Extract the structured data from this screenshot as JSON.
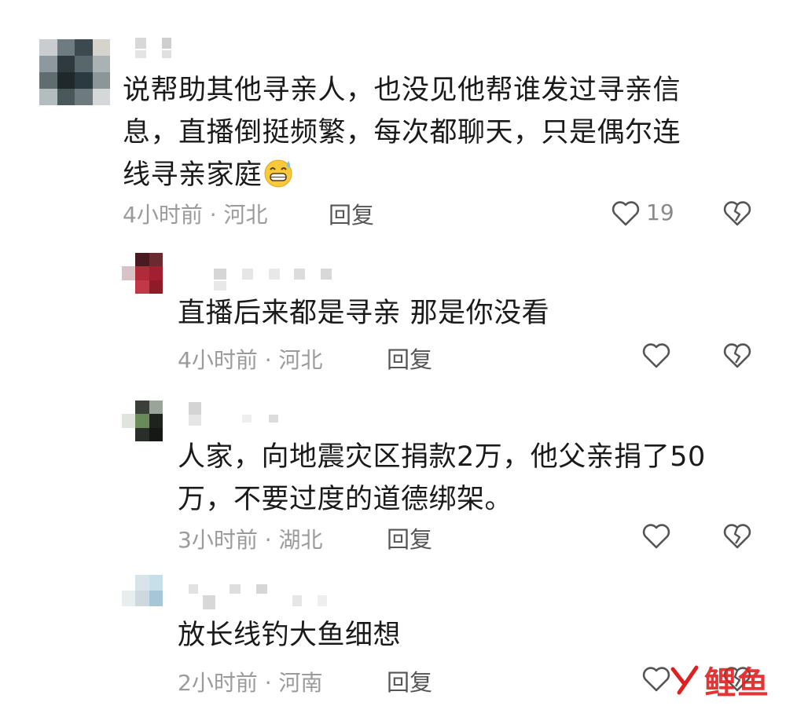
{
  "comments": [
    {
      "text": "说帮助其他寻亲人，也没见他帮谁发过寻亲信息，直播倒挺频繁，每次都聊天，只是偶尔连线寻亲家庭",
      "line1": "说帮助其他寻亲人，也没见他帮谁发过寻亲信",
      "line2": "息，直播倒挺频繁，每次都聊天，只是偶尔连",
      "line3": "线寻亲家庭",
      "meta": "4小时前 · 河北",
      "reply_label": "回复",
      "like_count": "19"
    },
    {
      "text": "直播后来都是寻亲 那是你没看",
      "meta": "4小时前 · 河北",
      "reply_label": "回复"
    },
    {
      "text": "人家，向地震灾区捐款2万，他父亲捐了50万，不要过度的道德绑架。",
      "line1": "人家，向地震灾区捐款2万，他父亲捐了50",
      "line2": "万，不要过度的道德绑架。",
      "meta": "3小时前 · 湖北",
      "reply_label": "回复"
    },
    {
      "text": "放长线钓大鱼细想",
      "meta": "2小时前 · 河南",
      "reply_label": "回复"
    }
  ],
  "icons": {
    "like": "heart-outline-icon",
    "dislike": "broken-heart-icon",
    "emoji": "grinning-sweat-emoji"
  },
  "watermark": {
    "text": "鲤鱼"
  },
  "colors": {
    "text": "#1a1a1a",
    "meta": "#9b9b9b",
    "watermark": "#e02020"
  }
}
